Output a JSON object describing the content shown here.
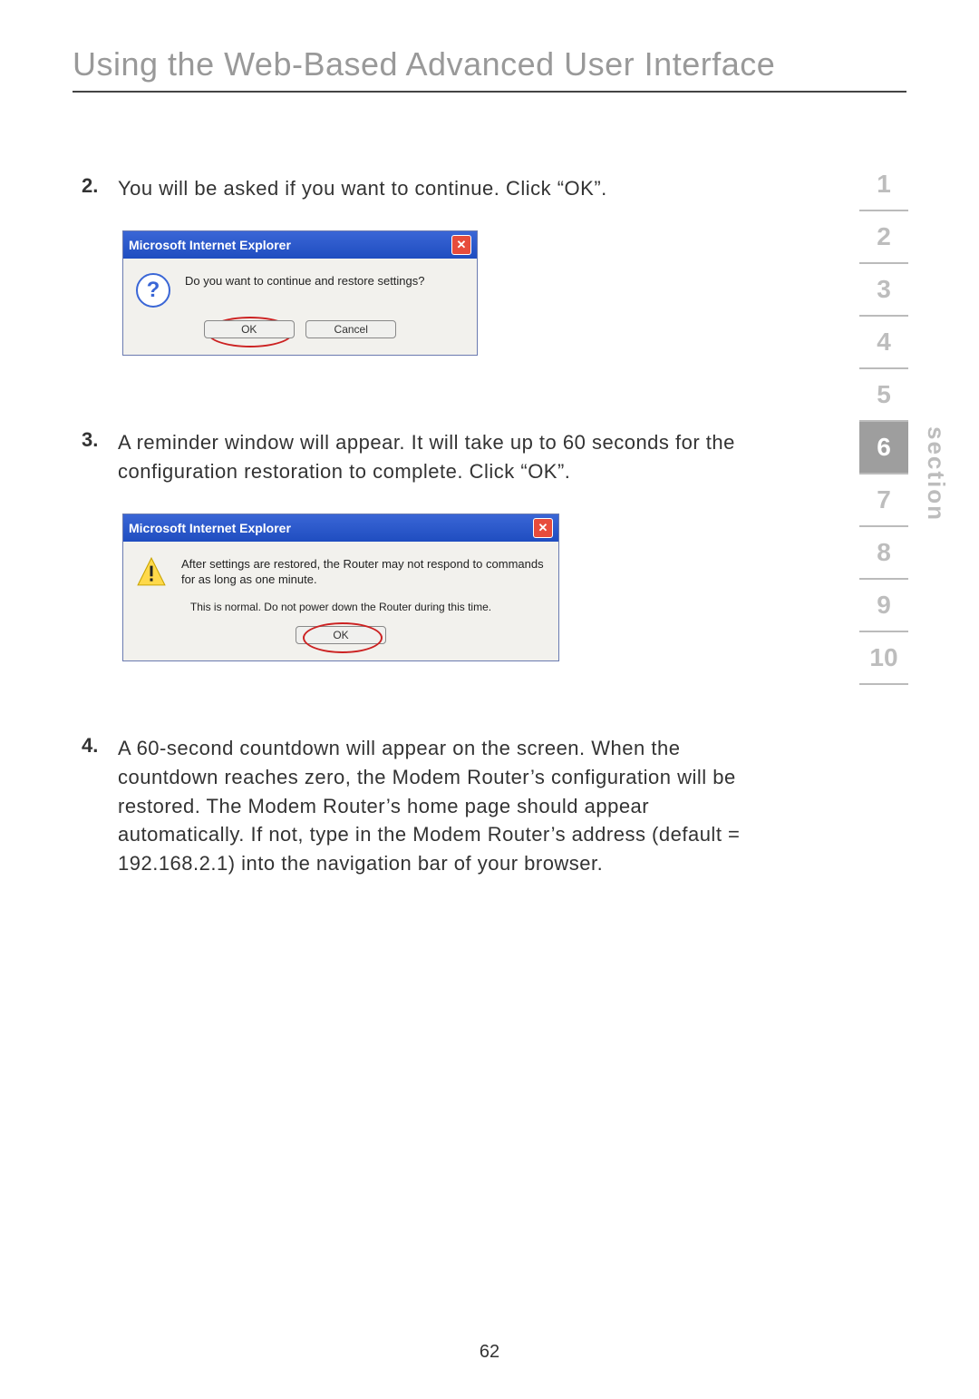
{
  "page": {
    "title": "Using the Web-Based Advanced User Interface",
    "number": "62"
  },
  "sectionNav": {
    "label": "section",
    "items": [
      "1",
      "2",
      "3",
      "4",
      "5",
      "6",
      "7",
      "8",
      "9",
      "10"
    ],
    "activeIndex": 5
  },
  "steps": {
    "s2": {
      "num": "2.",
      "text": "You will be asked if you want to continue. Click “OK”."
    },
    "s3": {
      "num": "3.",
      "text": "A reminder window will appear. It will take up to 60 seconds for the configuration restoration to complete. Click “OK”."
    },
    "s4": {
      "num": "4.",
      "text": "A 60-second countdown will appear on the screen. When the countdown reaches zero, the Modem Router’s configuration will be restored. The Modem Router’s home page should appear automatically. If not, type in the Modem Router’s address (default = 192.168.2.1) into the navigation bar of your browser."
    }
  },
  "dialog1": {
    "title": "Microsoft Internet Explorer",
    "message": "Do you want to continue and restore settings?",
    "ok": "OK",
    "cancel": "Cancel",
    "close": "✕"
  },
  "dialog2": {
    "title": "Microsoft Internet Explorer",
    "message1": "After settings are restored, the Router may not respond to commands for as long as one minute.",
    "message2": "This is normal. Do not power down the Router during this time.",
    "ok": "OK",
    "close": "✕"
  }
}
